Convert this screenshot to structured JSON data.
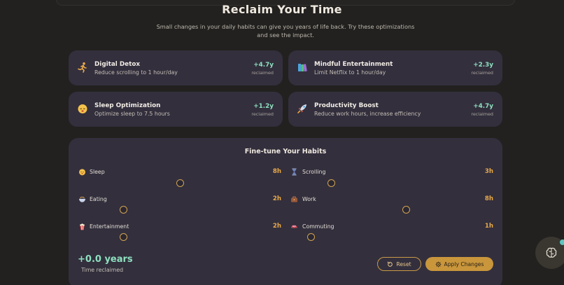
{
  "hero": {
    "title": "Reclaim Your Time",
    "subtitle": "Small changes in your daily habits can give you years of life back. Try these optimizations and see the impact."
  },
  "suggestions": [
    {
      "icon": "running-person-icon",
      "title": "Digital Detox",
      "desc": "Reduce scrolling to 1 hour/day",
      "gain": "+4.7y",
      "gain_label": "reclaimed"
    },
    {
      "icon": "books-icon",
      "title": "Mindful Entertainment",
      "desc": "Limit Netflix to 1 hour/day",
      "gain": "+2.3y",
      "gain_label": "reclaimed"
    },
    {
      "icon": "sleeping-face-icon",
      "title": "Sleep Optimization",
      "desc": "Optimize sleep to 7.5 hours",
      "gain": "+1.2y",
      "gain_label": "reclaimed"
    },
    {
      "icon": "rocket-icon",
      "title": "Productivity Boost",
      "desc": "Reduce work hours, increase efficiency",
      "gain": "+4.7y",
      "gain_label": "reclaimed"
    }
  ],
  "finetune": {
    "title": "Fine-tune Your Habits",
    "habits": [
      {
        "icon": "sleeping-face-icon",
        "label": "Sleep",
        "value": "8h",
        "level": 0.5
      },
      {
        "icon": "hourglass-icon",
        "label": "Scrolling",
        "value": "3h",
        "level": 0.2
      },
      {
        "icon": "food-bowl-icon",
        "label": "Eating",
        "value": "2h",
        "level": 0.22
      },
      {
        "icon": "briefcase-icon",
        "label": "Work",
        "value": "8h",
        "level": 0.57
      },
      {
        "icon": "popcorn-icon",
        "label": "Entertainment",
        "value": "2h",
        "level": 0.22
      },
      {
        "icon": "car-icon",
        "label": "Commuting",
        "value": "1h",
        "level": 0.1
      }
    ],
    "total_value": "+0.0 years",
    "total_label": "Time reclaimed",
    "reset_label": "Reset",
    "apply_label": "Apply Changes"
  },
  "colors": {
    "background": "#22211f",
    "card": "#332f3d",
    "accent_green": "#8ee0bf",
    "accent_amber": "#e8a94a",
    "button_gold": "#c9963c"
  }
}
